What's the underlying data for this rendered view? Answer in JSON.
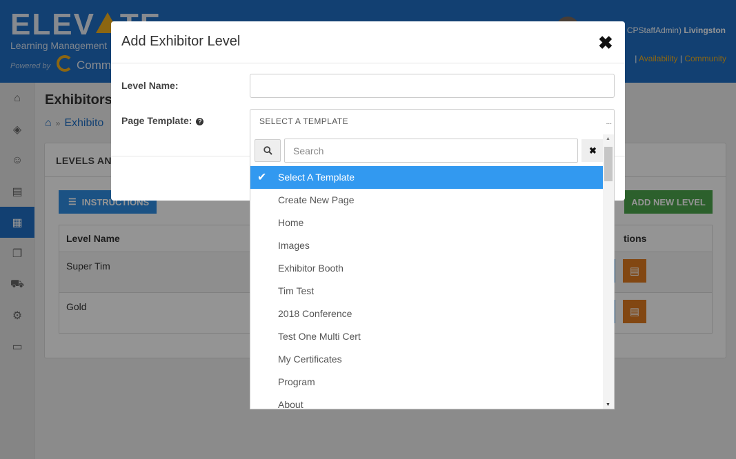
{
  "header": {
    "logo_text_left": "ELEV",
    "logo_text_right": "TE",
    "logo_subtitle": "Learning Management",
    "powered_by": "Powered by",
    "powered_name": "Comm",
    "user_role": "CPStaffAdmin)",
    "user_name": "Livingston",
    "links": [
      "Availability",
      "Community"
    ],
    "link_separator": "|"
  },
  "sidebar": {
    "items": [
      {
        "icon": "home-icon",
        "glyph": "⌂"
      },
      {
        "icon": "layers-icon",
        "glyph": "◈"
      },
      {
        "icon": "users-icon",
        "glyph": "☺"
      },
      {
        "icon": "book-icon",
        "glyph": "▤"
      },
      {
        "icon": "grid-icon",
        "glyph": "▦"
      },
      {
        "icon": "clipboard-icon",
        "glyph": "❐"
      },
      {
        "icon": "cart-icon",
        "glyph": "⛟"
      },
      {
        "icon": "gear-icon",
        "glyph": "⚙"
      },
      {
        "icon": "monitor-icon",
        "glyph": "▭"
      }
    ],
    "active_index": 4
  },
  "page": {
    "title": "Exhibitors",
    "breadcrumb_sep": "»",
    "breadcrumb_item": "Exhibito",
    "panel_title": "LEVELS AND",
    "instructions_label": "INSTRUCTIONS",
    "add_level_label": "ADD NEW LEVEL",
    "table": {
      "headers": [
        "Level Name",
        "tions"
      ],
      "rows": [
        {
          "name": "Super Tim"
        },
        {
          "name": "Gold"
        }
      ]
    }
  },
  "modal": {
    "title": "Add Exhibitor Level",
    "close_glyph": "✖",
    "level_name_label": "Level Name:",
    "level_name_value": "",
    "page_template_label": "Page Template:",
    "select_value": "SELECT A TEMPLATE",
    "select_dots": "..."
  },
  "dropdown": {
    "search_placeholder": "Search",
    "clear_glyph": "✖",
    "options": [
      "Select A Template",
      "Create New Page",
      "Home",
      "Images",
      "Exhibitor Booth",
      "Tim Test",
      "2018 Conference",
      "Test One Multi Cert",
      "My Certificates",
      "Program",
      "About"
    ],
    "selected_index": 0
  },
  "colors": {
    "brand_blue": "#1f6fc5",
    "accent_yellow": "#f2b01e",
    "selected_blue": "#3299f0",
    "add_green": "#4ca64c",
    "action_orange": "#e07a1f"
  }
}
